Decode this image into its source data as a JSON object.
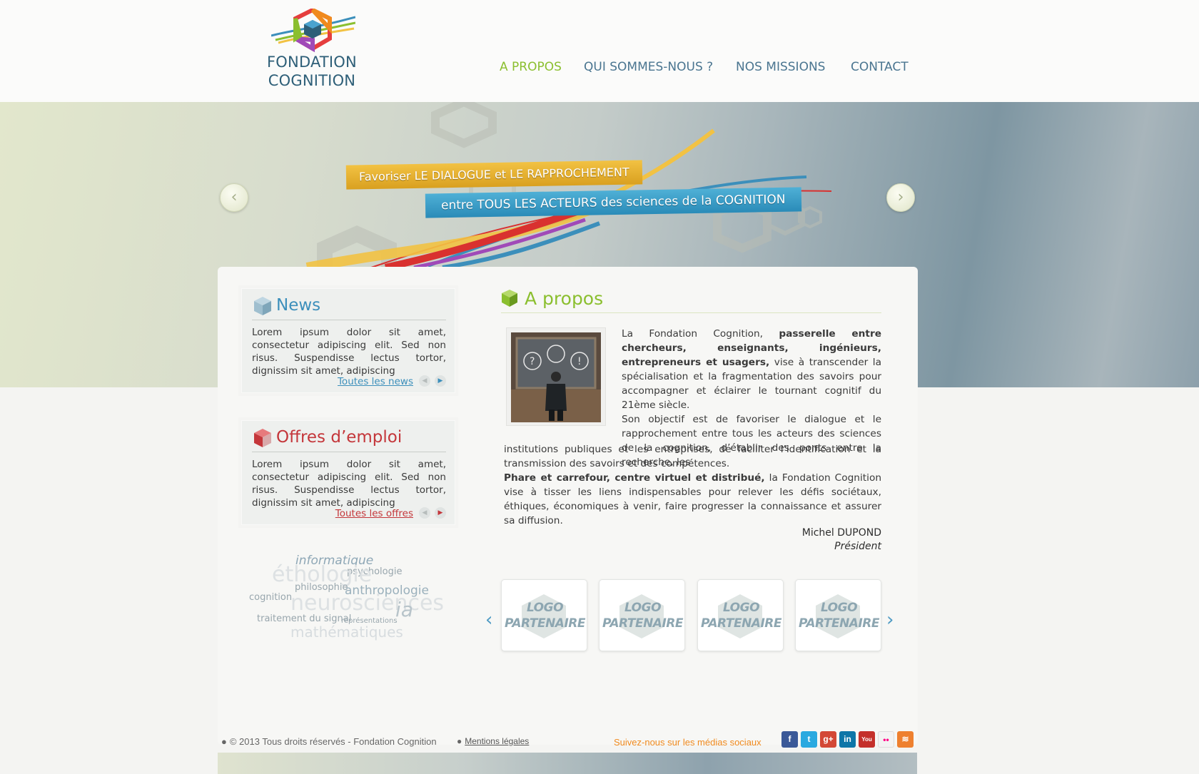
{
  "brand": {
    "line1": "FONDATION",
    "line2": "COGNITION"
  },
  "nav": {
    "items": [
      {
        "label": "A PROPOS",
        "active": true
      },
      {
        "label": "QUI SOMMES-NOUS ?",
        "active": false
      },
      {
        "label": "NOS MISSIONS",
        "active": false
      },
      {
        "label": "CONTACT",
        "active": false
      }
    ]
  },
  "banner": {
    "ribbon1": "Favoriser LE DIALOGUE et LE RAPPROCHEMENT",
    "ribbon2": "entre TOUS LES ACTEURS des sciences de la COGNITION",
    "prev_icon": "chevron-left-icon",
    "next_icon": "chevron-right-icon"
  },
  "news": {
    "title": "News",
    "text": "Lorem ipsum dolor sit amet, consectetur adipiscing elit. Sed non risus. Suspendisse lectus tortor, dignissim sit amet, adipiscing",
    "link": "Toutes les news",
    "accent": "#3c8fbb"
  },
  "offres": {
    "title": "Offres d’emploi",
    "text": "Lorem ipsum dolor sit amet, consectetur adipiscing elit. Sed non risus. Suspendisse lectus tortor, dignissim sit amet, adipiscing",
    "link": "Toutes les offres",
    "accent": "#c4363a"
  },
  "tags": [
    "informatique",
    "psychologie",
    "éthologie",
    "philosophie",
    "anthropologie",
    "cognition",
    "neurosciences",
    "ia",
    "traitement du signal",
    "représentations",
    "mathématiques"
  ],
  "apropos": {
    "title": "A propos",
    "p1_a": "La Fondation Cognition, ",
    "p1_b": "passerelle entre chercheurs, enseignants, ingénieurs, entrepreneurs et usagers,",
    "p1_c": " vise à transcender la spécialisation et la fragmentation des savoirs pour accompagner et éclairer le tournant cognitif du 21ème siècle.",
    "p2": "Son objectif est de favoriser le dialogue et le rapprochement entre tous les acteurs des sciences de la cognition, d’établir des ponts entre la recherche, les",
    "p3": "institutions publiques et les entreprises, de faciliter l’identification et la transmission des savoirs et des compétences.",
    "p4_b": "Phare et carrefour, centre virtuel et distribué,",
    "p4_c": " la Fondation Cognition vise à tisser les liens indispensables pour relever les défis sociétaux, éthiques, économiques à venir, faire progresser la connaissance et assurer sa diffusion.",
    "signature_name": "Michel DUPOND",
    "signature_role": "Président",
    "accent": "#8bbf2f"
  },
  "partners": {
    "items": [
      {
        "line1": "LOGO",
        "line2": "PARTENAIRE"
      },
      {
        "line1": "LOGO",
        "line2": "PARTENAIRE"
      },
      {
        "line1": "LOGO",
        "line2": "PARTENAIRE"
      },
      {
        "line1": "LOGO",
        "line2": "PARTENAIRE"
      }
    ]
  },
  "footer": {
    "copyright": "© 2013 Tous droits réservés - Fondation Cognition",
    "legal": "Mentions légales",
    "follow": "Suivez-nous sur les médias sociaux",
    "social": [
      {
        "name": "facebook-icon",
        "glyph": "f",
        "color": "#3b5998"
      },
      {
        "name": "twitter-icon",
        "glyph": "t",
        "color": "#2aa9e0"
      },
      {
        "name": "google-plus-icon",
        "glyph": "g+",
        "color": "#d34836"
      },
      {
        "name": "linkedin-icon",
        "glyph": "in",
        "color": "#0e76a8"
      },
      {
        "name": "youtube-icon",
        "glyph": "You",
        "color": "#c4302b"
      },
      {
        "name": "flickr-icon",
        "glyph": "••",
        "color": "#f3f3f3"
      },
      {
        "name": "rss-icon",
        "glyph": "≋",
        "color": "#ee802f"
      }
    ]
  }
}
